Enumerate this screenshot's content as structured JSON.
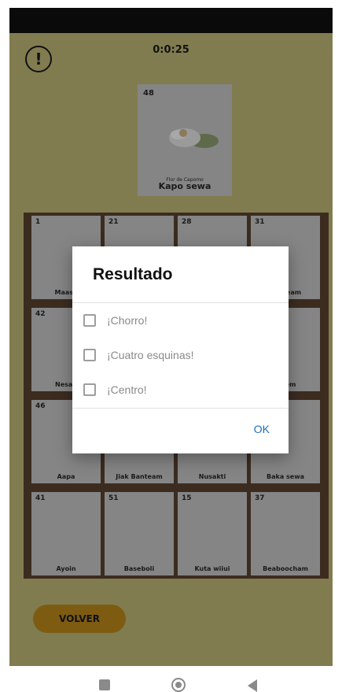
{
  "timer": "0:0:25",
  "current_card": {
    "number": "48",
    "subtitle": "Flor de Capomo",
    "name": "Kapo sewa"
  },
  "board": {
    "cards": [
      {
        "number": "1",
        "name": "Maaso"
      },
      {
        "number": "21",
        "name": ""
      },
      {
        "number": "28",
        "name": ""
      },
      {
        "number": "31",
        "name": "Banteam"
      },
      {
        "number": "42",
        "name": "Nesau"
      },
      {
        "number": "",
        "name": ""
      },
      {
        "number": "",
        "name": ""
      },
      {
        "number": "",
        "name": "Hitem"
      },
      {
        "number": "46",
        "name": "Aapa"
      },
      {
        "number": "",
        "name": "Jiak Banteam"
      },
      {
        "number": "",
        "name": "Nusakti"
      },
      {
        "number": "",
        "name": "Baka sewa"
      },
      {
        "number": "41",
        "name": "Ayoin"
      },
      {
        "number": "51",
        "name": "Baseboli"
      },
      {
        "number": "15",
        "name": "Kuta wiiui"
      },
      {
        "number": "37",
        "name": "Beaboocham"
      }
    ]
  },
  "back_button": "VOLVER",
  "dialog": {
    "title": "Resultado",
    "options": [
      {
        "label": "¡Chorro!",
        "checked": false
      },
      {
        "label": "¡Cuatro esquinas!",
        "checked": false
      },
      {
        "label": "¡Centro!",
        "checked": false
      }
    ],
    "ok_label": "OK"
  },
  "nav": {
    "square_icon": "recent-apps-icon",
    "circle_icon": "home-icon",
    "triangle_icon": "back-icon"
  },
  "colors": {
    "background": "#817c4f",
    "board": "#3c2c20",
    "button": "#7d5c12",
    "ok": "#1b6fb8"
  }
}
